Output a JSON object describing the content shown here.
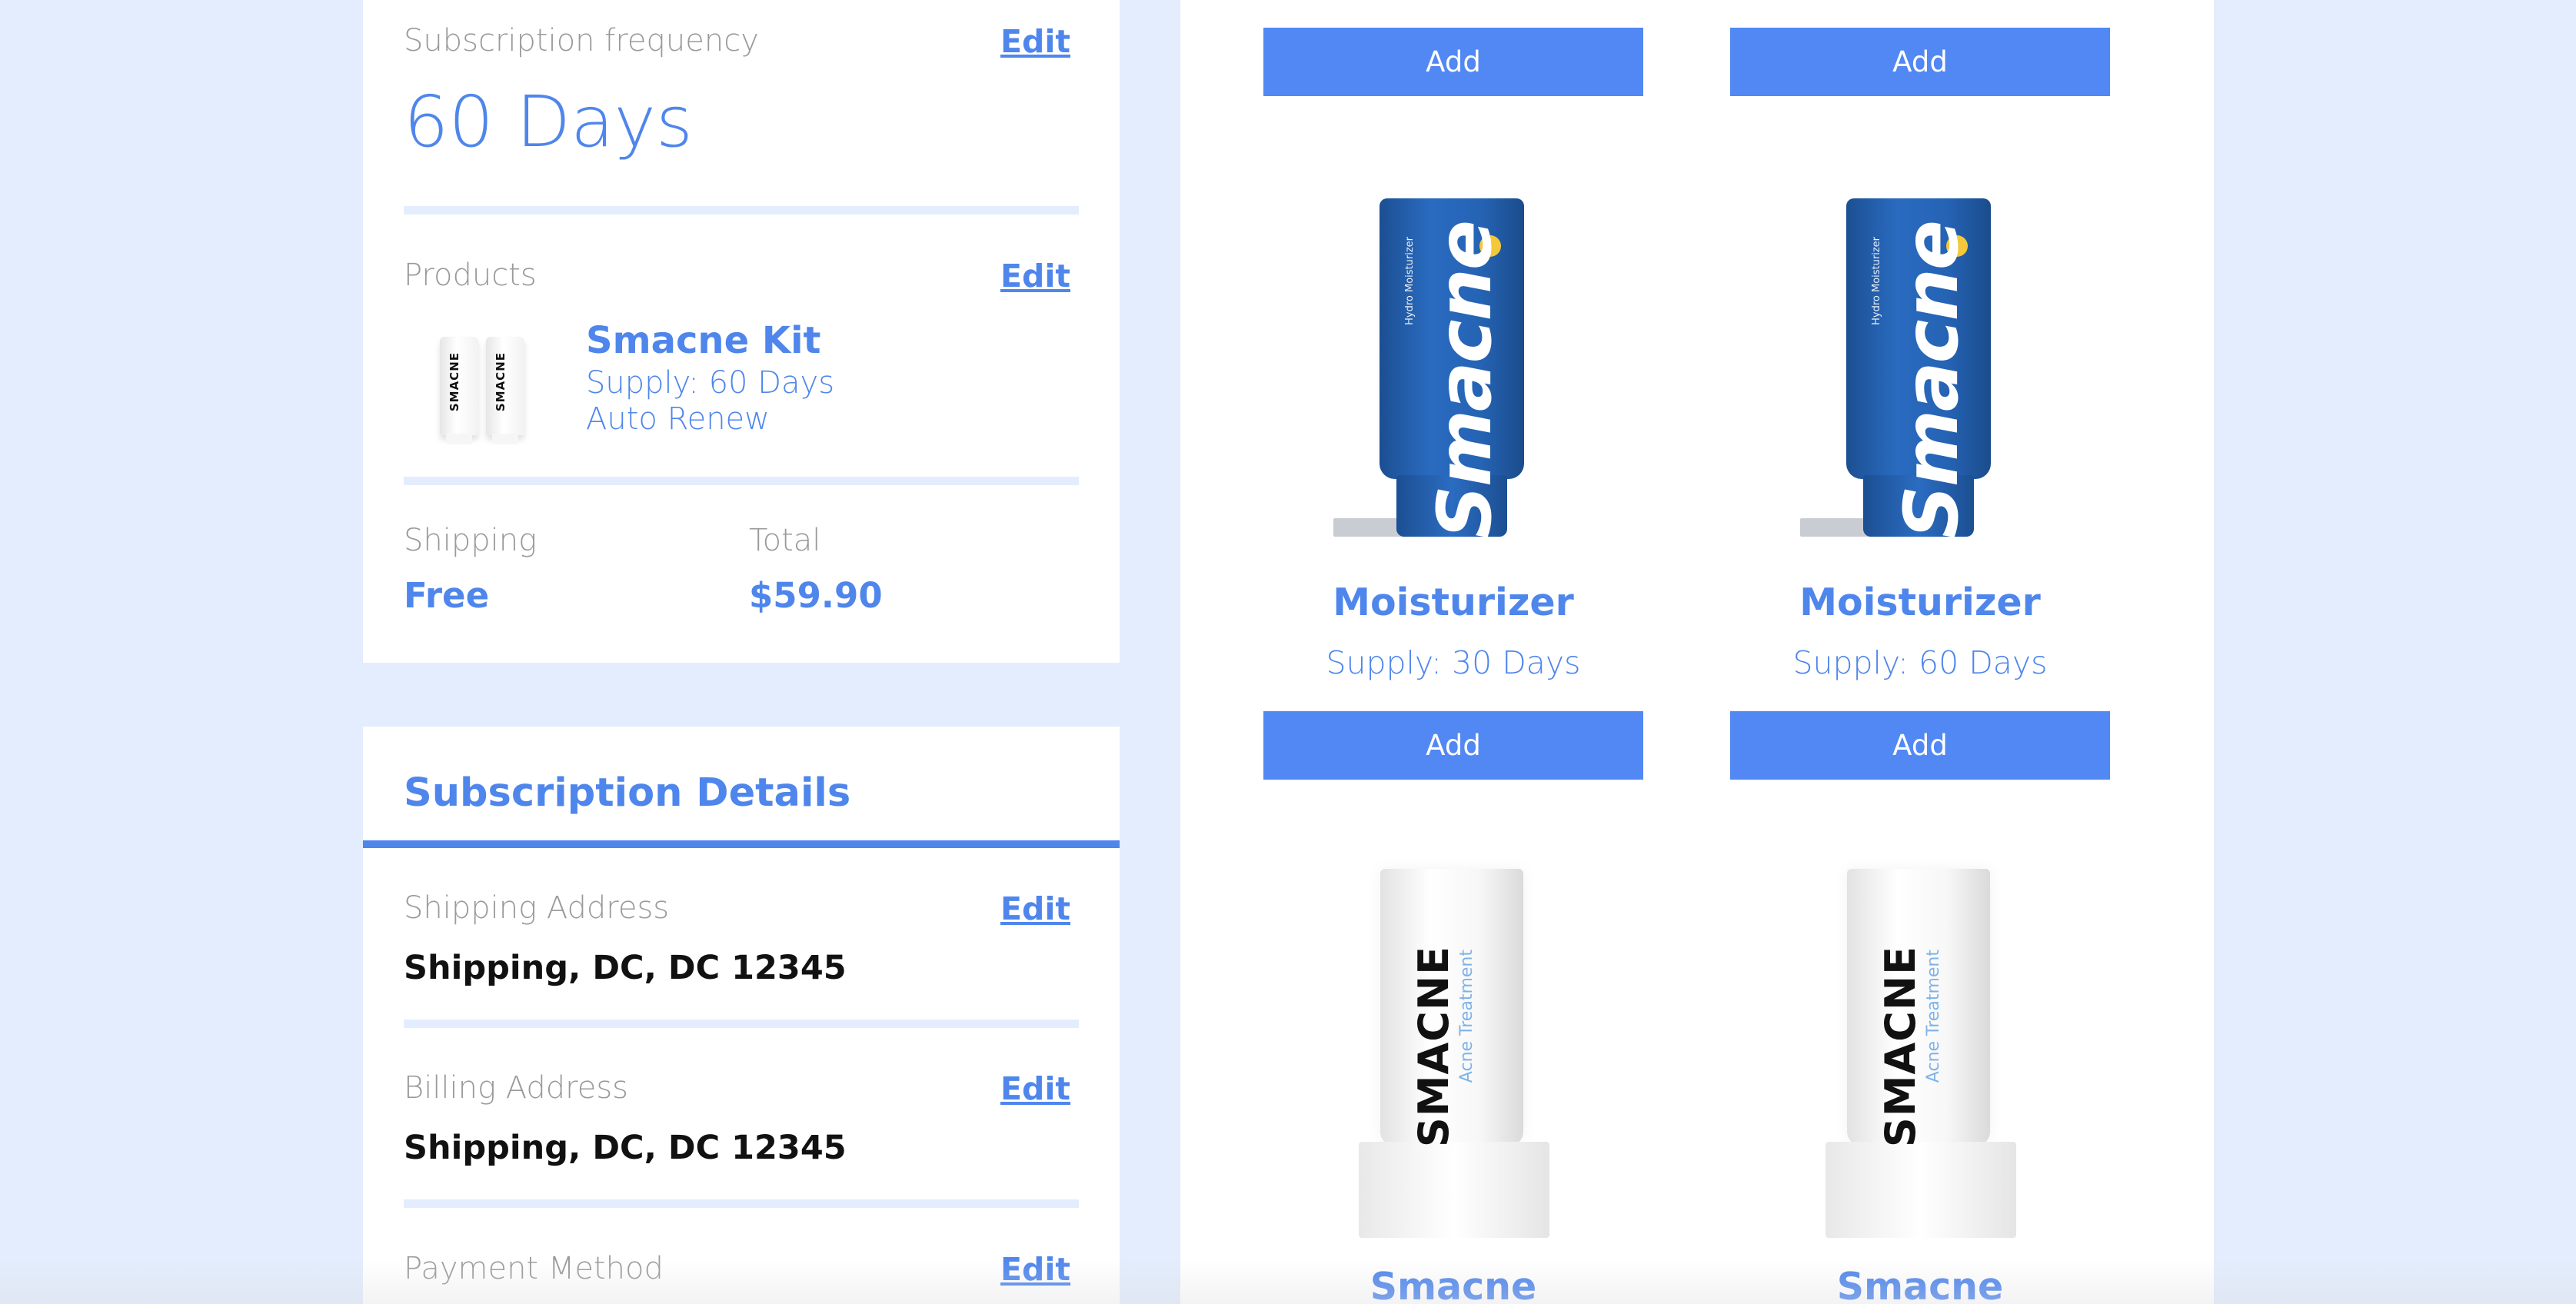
{
  "summary": {
    "frequency_label": "Subscription frequency",
    "frequency_value": "60 Days",
    "edit_label": "Edit",
    "products_label": "Products",
    "product": {
      "name": "Smacne Kit",
      "supply": "Supply: 60 Days",
      "renew": "Auto Renew",
      "thumb_text": "SMACNE"
    },
    "shipping_label": "Shipping",
    "shipping_value": "Free",
    "total_label": "Total",
    "total_value": "$59.90"
  },
  "details": {
    "title": "Subscription Details",
    "shipping_address_label": "Shipping Address",
    "shipping_address_value": "Shipping, DC, DC 12345",
    "billing_address_label": "Billing Address",
    "billing_address_value": "Shipping, DC, DC 12345",
    "payment_method_label": "Payment Method"
  },
  "catalog": {
    "add_label": "Add",
    "products": [
      {
        "title": "Moisturizer",
        "supply": "Supply: 30 Days",
        "brand": "Smacne",
        "sub": "Hydro Moisturizer"
      },
      {
        "title": "Moisturizer",
        "supply": "Supply: 60 Days",
        "brand": "Smacne",
        "sub": "Hydro Moisturizer"
      },
      {
        "title": "Smacne Treatment",
        "brand": "SMACNE",
        "sub": "Acne Treatment"
      },
      {
        "title": "Smacne Treatment",
        "brand": "SMACNE",
        "sub": "Acne Treatment"
      }
    ]
  },
  "colors": {
    "accent": "#4f86ec",
    "button": "#5288f3",
    "page_bg": "#e3edfd"
  }
}
